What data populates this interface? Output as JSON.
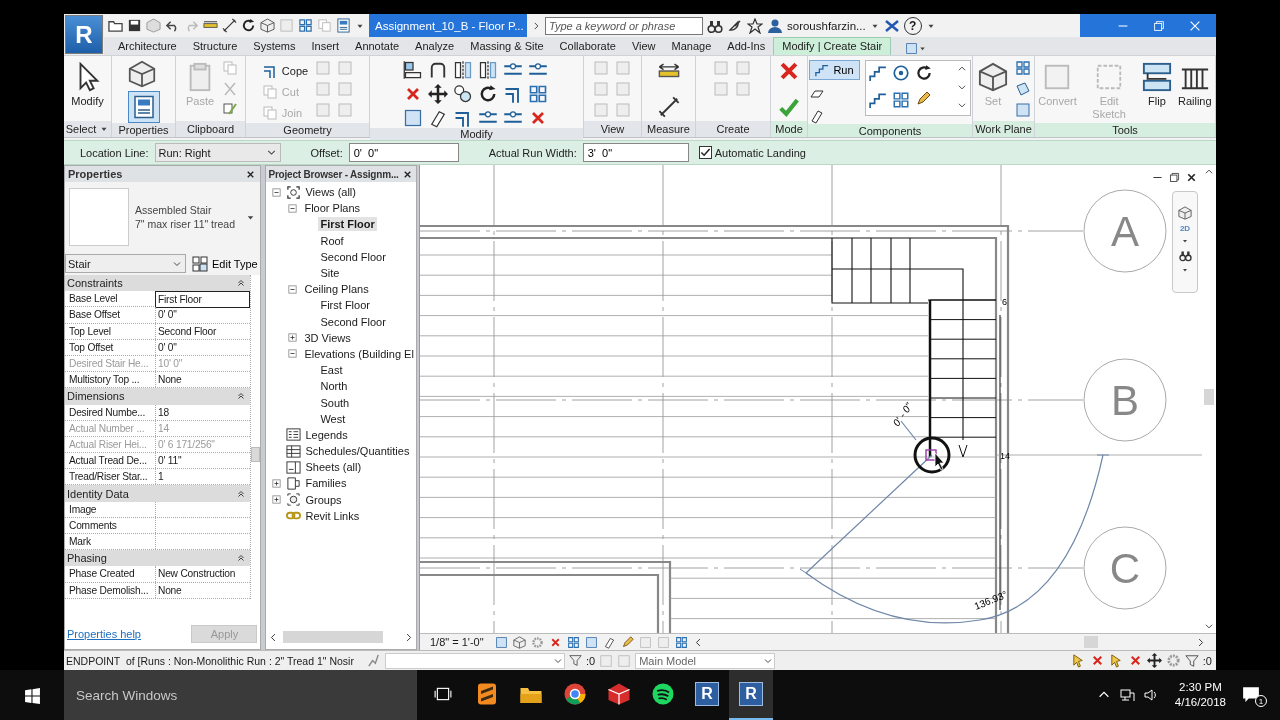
{
  "title_bar": {
    "app_menu_label": "R",
    "document_tab": "Assignment_10_B - Floor P...",
    "search": {
      "placeholder": "Type a keyword or phrase"
    },
    "user": "soroushfarzin...",
    "help_label": "?"
  },
  "ribbon_tabs": [
    {
      "label": "Architecture",
      "selected": false
    },
    {
      "label": "Structure",
      "selected": false
    },
    {
      "label": "Systems",
      "selected": false
    },
    {
      "label": "Insert",
      "selected": false
    },
    {
      "label": "Annotate",
      "selected": false
    },
    {
      "label": "Analyze",
      "selected": false
    },
    {
      "label": "Massing & Site",
      "selected": false
    },
    {
      "label": "Collaborate",
      "selected": false
    },
    {
      "label": "View",
      "selected": false
    },
    {
      "label": "Manage",
      "selected": false
    },
    {
      "label": "Add-Ins",
      "selected": false
    },
    {
      "label": "Modify | Create Stair",
      "selected": true
    }
  ],
  "ribbon_panels": [
    {
      "title": "Select",
      "contextual": false,
      "tools": [
        {
          "kind": "large",
          "label": "Modify",
          "disabled": false
        }
      ]
    },
    {
      "title": "Properties",
      "contextual": false
    },
    {
      "title": "Clipboard",
      "contextual": false,
      "tools": [
        {
          "kind": "large",
          "label": "Paste",
          "disabled": true
        }
      ]
    },
    {
      "title": "Geometry",
      "contextual": false,
      "tools": [
        {
          "kind": "small",
          "label": "Cope",
          "disabled": false
        },
        {
          "kind": "small",
          "label": "Cut",
          "disabled": true
        },
        {
          "kind": "small",
          "label": "Join",
          "disabled": true
        }
      ]
    },
    {
      "title": "Modify",
      "contextual": false
    },
    {
      "title": "View",
      "contextual": false
    },
    {
      "title": "Measure",
      "contextual": false
    },
    {
      "title": "Create",
      "contextual": false
    },
    {
      "title": "Mode",
      "contextual": true
    },
    {
      "title": "Components",
      "contextual": true,
      "tools": [
        {
          "kind": "toggle",
          "label": "Run",
          "selected": true
        }
      ]
    },
    {
      "title": "Work Plane",
      "contextual": true,
      "tools": [
        {
          "kind": "large",
          "label": "Set",
          "disabled": true
        }
      ]
    },
    {
      "title": "Tools",
      "contextual": true,
      "tools": [
        {
          "kind": "large",
          "label": "Convert",
          "disabled": true
        },
        {
          "kind": "large",
          "label": "Edit Sketch",
          "disabled": true
        },
        {
          "kind": "large",
          "label": "Flip",
          "disabled": false
        },
        {
          "kind": "large",
          "label": "Railing",
          "disabled": false
        }
      ]
    }
  ],
  "options_bar": {
    "location_line": {
      "label": "Location Line:",
      "value": "Run: Right"
    },
    "offset": {
      "label": "Offset:",
      "value": "0'  0\""
    },
    "run_width": {
      "label": "Actual Run Width:",
      "value": "3'  0\""
    },
    "automatic_landing": {
      "label": "Automatic Landing",
      "checked": true
    }
  },
  "properties": {
    "title": "Properties",
    "type_name": "Assembled Stair",
    "type_detail": "7\" max riser 11\" tread",
    "category": "Stair",
    "edit_type": "Edit Type",
    "groups": [
      {
        "name": "Constraints",
        "expanded": true,
        "rows": [
          {
            "name": "Base Level",
            "value": "First Floor",
            "disabled": false,
            "focused": true
          },
          {
            "name": "Base Offset",
            "value": "0'  0\"",
            "disabled": false,
            "focused": false
          },
          {
            "name": "Top Level",
            "value": "Second Floor",
            "disabled": false,
            "focused": false
          },
          {
            "name": "Top Offset",
            "value": "0'  0\"",
            "disabled": false,
            "focused": false
          },
          {
            "name": "Desired Stair He...",
            "value": "10'  0\"",
            "disabled": true,
            "focused": false
          },
          {
            "name": "Multistory Top ...",
            "value": "None",
            "disabled": false,
            "focused": false
          }
        ]
      },
      {
        "name": "Dimensions",
        "expanded": true,
        "rows": [
          {
            "name": "Desired Numbe...",
            "value": "18",
            "disabled": false,
            "focused": false
          },
          {
            "name": "Actual Number ...",
            "value": "14",
            "disabled": true,
            "focused": false
          },
          {
            "name": "Actual Riser Hei...",
            "value": "0'  6 171/256\"",
            "disabled": true,
            "focused": false
          },
          {
            "name": "Actual Tread De...",
            "value": "0'  11\"",
            "disabled": false,
            "focused": false
          },
          {
            "name": "Tread/Riser Star...",
            "value": "1",
            "disabled": false,
            "focused": false
          }
        ]
      },
      {
        "name": "Identity Data",
        "expanded": true,
        "rows": [
          {
            "name": "Image",
            "disabled": false,
            "focused": false
          },
          {
            "name": "Comments",
            "disabled": false,
            "focused": false
          },
          {
            "name": "Mark",
            "disabled": false,
            "focused": false
          }
        ]
      },
      {
        "name": "Phasing",
        "expanded": true,
        "rows": [
          {
            "name": "Phase Created",
            "value": "New Construction",
            "disabled": false,
            "focused": false
          },
          {
            "name": "Phase Demolish...",
            "value": "None",
            "disabled": false,
            "focused": false
          }
        ]
      }
    ],
    "help_link": "Properties help",
    "apply": {
      "label": "Apply",
      "disabled": true
    }
  },
  "project_browser": {
    "title": "Project Browser - Assignm...",
    "tree": [
      {
        "label": "Views (all)",
        "expanded": true,
        "selected": false,
        "children": [
          {
            "label": "Floor Plans",
            "expanded": true,
            "selected": false,
            "children": [
              {
                "label": "First Floor",
                "selected": true
              },
              {
                "label": "Roof",
                "selected": false
              },
              {
                "label": "Second Floor",
                "selected": false
              },
              {
                "label": "Site",
                "selected": false
              }
            ]
          },
          {
            "label": "Ceiling Plans",
            "expanded": true,
            "selected": false,
            "children": [
              {
                "label": "First Floor",
                "selected": false
              },
              {
                "label": "Second Floor",
                "selected": false
              }
            ]
          },
          {
            "label": "3D Views",
            "expanded": false,
            "selected": false
          },
          {
            "label": "Elevations (Building El",
            "expanded": true,
            "selected": false,
            "children": [
              {
                "label": "East",
                "selected": false
              },
              {
                "label": "North",
                "selected": false
              },
              {
                "label": "South",
                "selected": false
              },
              {
                "label": "West",
                "selected": false
              }
            ]
          }
        ]
      },
      {
        "label": "Legends",
        "selected": false
      },
      {
        "label": "Schedules/Quantities",
        "selected": false
      },
      {
        "label": "Sheets (all)",
        "selected": false
      },
      {
        "label": "Families",
        "expanded": false,
        "selected": false
      },
      {
        "label": "Groups",
        "expanded": false,
        "selected": false
      },
      {
        "label": "Revit Links",
        "selected": false
      }
    ]
  },
  "canvas": {
    "grid_labels": [
      "A",
      "B",
      "C"
    ],
    "riser_labels": [
      "6",
      "14"
    ],
    "dimension": "0' - 0\"",
    "angle": "136.93°",
    "nav_bar_label": "2D",
    "scale": "1/8\" = 1'-0\""
  },
  "status_bar": {
    "message": "ENDPOINT  of [Runs : Non-Monolithic Run : 2\" Tread 1\" Nosir",
    "editable_count": ":0",
    "model": "Main Model",
    "filter_count": ":0"
  },
  "taskbar": {
    "search": {
      "placeholder": "Search Windows"
    },
    "apps": [
      {
        "kind": "sublime",
        "active": false
      },
      {
        "kind": "folder",
        "active": false
      },
      {
        "kind": "chrome",
        "active": false
      },
      {
        "kind": "sketchup",
        "active": false
      },
      {
        "kind": "spotify",
        "active": false
      },
      {
        "kind": "revit",
        "label": "R",
        "active": false
      },
      {
        "kind": "revit",
        "label": "R",
        "active": true
      }
    ],
    "time": "2:30 PM",
    "date": "4/16/2018",
    "notifications": "1"
  }
}
